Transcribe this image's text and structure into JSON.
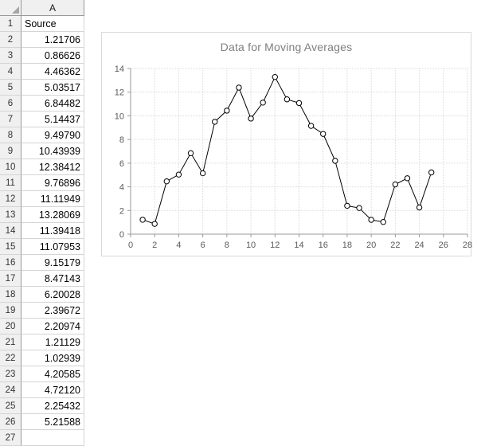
{
  "spreadsheet": {
    "column_header": "A",
    "rows": [
      {
        "num": "1",
        "value": "Source",
        "type": "text"
      },
      {
        "num": "2",
        "value": "1.21706",
        "type": "number"
      },
      {
        "num": "3",
        "value": "0.86626",
        "type": "number"
      },
      {
        "num": "4",
        "value": "4.46362",
        "type": "number"
      },
      {
        "num": "5",
        "value": "5.03517",
        "type": "number"
      },
      {
        "num": "6",
        "value": "6.84482",
        "type": "number"
      },
      {
        "num": "7",
        "value": "5.14437",
        "type": "number"
      },
      {
        "num": "8",
        "value": "9.49790",
        "type": "number"
      },
      {
        "num": "9",
        "value": "10.43939",
        "type": "number"
      },
      {
        "num": "10",
        "value": "12.38412",
        "type": "number"
      },
      {
        "num": "11",
        "value": "9.76896",
        "type": "number"
      },
      {
        "num": "12",
        "value": "11.11949",
        "type": "number"
      },
      {
        "num": "13",
        "value": "13.28069",
        "type": "number"
      },
      {
        "num": "14",
        "value": "11.39418",
        "type": "number"
      },
      {
        "num": "15",
        "value": "11.07953",
        "type": "number"
      },
      {
        "num": "16",
        "value": "9.15179",
        "type": "number"
      },
      {
        "num": "17",
        "value": "8.47143",
        "type": "number"
      },
      {
        "num": "18",
        "value": "6.20028",
        "type": "number"
      },
      {
        "num": "19",
        "value": "2.39672",
        "type": "number"
      },
      {
        "num": "20",
        "value": "2.20974",
        "type": "number"
      },
      {
        "num": "21",
        "value": "1.21129",
        "type": "number"
      },
      {
        "num": "22",
        "value": "1.02939",
        "type": "number"
      },
      {
        "num": "23",
        "value": "4.20585",
        "type": "number"
      },
      {
        "num": "24",
        "value": "4.72120",
        "type": "number"
      },
      {
        "num": "25",
        "value": "2.25432",
        "type": "number"
      },
      {
        "num": "26",
        "value": "5.21588",
        "type": "number"
      },
      {
        "num": "27",
        "value": "",
        "type": "empty"
      }
    ]
  },
  "chart_data": {
    "type": "line",
    "title": "Data for Moving Averages",
    "xlabel": "",
    "ylabel": "",
    "x": [
      1,
      2,
      3,
      4,
      5,
      6,
      7,
      8,
      9,
      10,
      11,
      12,
      13,
      14,
      15,
      16,
      17,
      18,
      19,
      20,
      21,
      22,
      23,
      24,
      25
    ],
    "values": [
      1.21706,
      0.86626,
      4.46362,
      5.03517,
      6.84482,
      5.14437,
      9.4979,
      10.43939,
      12.38412,
      9.76896,
      11.11949,
      13.28069,
      11.39418,
      11.07953,
      9.15179,
      8.47143,
      6.20028,
      2.39672,
      2.20974,
      1.21129,
      1.02939,
      4.20585,
      4.7212,
      2.25432,
      5.21588
    ],
    "series_name": "Source",
    "xlim": [
      0,
      28
    ],
    "ylim": [
      0,
      14
    ],
    "xticks": [
      0,
      2,
      4,
      6,
      8,
      10,
      12,
      14,
      16,
      18,
      20,
      22,
      24,
      26,
      28
    ],
    "yticks": [
      0,
      2,
      4,
      6,
      8,
      10,
      12,
      14
    ],
    "grid": true,
    "legend": "none",
    "line_color": "#000000",
    "marker": "open-circle",
    "marker_fill": "#ffffff",
    "gridline_color": "#d9d9d9",
    "title_color": "#7f7f7f",
    "tick_label_color": "#595959",
    "border_color": "#d9d9d9"
  }
}
